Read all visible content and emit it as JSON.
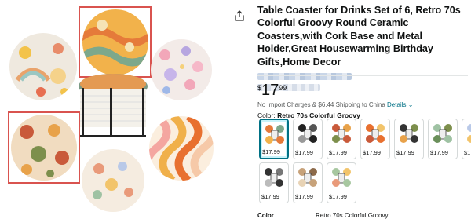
{
  "product": {
    "title": "Table Coaster for Drinks Set of 6, Retro 70s Colorful Groovy Round Ceramic Coasters,with Cork Base and Metal Holder,Great Housewarming Birthday Gifts,Home Decor",
    "price_symbol": "$",
    "price_whole": "17",
    "price_fraction": "99",
    "shipping_text": "No Import Charges & $6.44 Shipping to China",
    "shipping_link": "Details",
    "color_label": "Color:",
    "color_value": "Retro 70s Colorful Groovy"
  },
  "swatches": [
    {
      "price": "$17.99",
      "selected": true
    },
    {
      "price": "$17.99",
      "selected": false
    },
    {
      "price": "$17.99",
      "selected": false
    },
    {
      "price": "$17.99",
      "selected": false
    },
    {
      "price": "$17.99",
      "selected": false
    },
    {
      "price": "$17.99",
      "selected": false
    },
    {
      "price": "$17.99",
      "selected": false
    },
    {
      "price": "$17.99",
      "selected": false
    },
    {
      "price": "$17.99",
      "selected": false
    },
    {
      "price": "$17.99",
      "selected": false
    }
  ],
  "bottom_row": {
    "label": "Color",
    "value": "Retro 70s Colorful Groovy"
  },
  "colors": {
    "link": "#007185",
    "selected_border": "#007185",
    "highlight_frame": "#d9534f"
  }
}
